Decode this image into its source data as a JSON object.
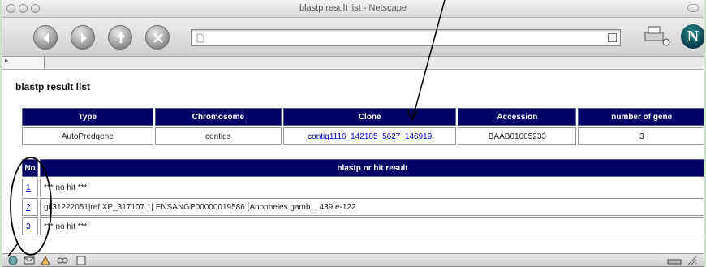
{
  "window": {
    "title": "blastp result list - Netscape"
  },
  "page": {
    "heading": "blastp result list"
  },
  "main_table": {
    "headers": [
      "Type",
      "Chromosome",
      "Clone",
      "Accession",
      "number of gene"
    ],
    "row": {
      "type": "AutoPredgene",
      "chromosome": "contigs",
      "clone": "contig1116_142105_5627_146919",
      "accession": "BAAB01005233",
      "gene_count": "3"
    }
  },
  "hits_table": {
    "headers": [
      "No",
      "blastp nr hit result"
    ],
    "rows": [
      {
        "no": "1",
        "result": "*** no hit ***"
      },
      {
        "no": "2",
        "result": "gi|31222051|ref|XP_317107.1| ENSANGP00000019586 [Anopheles gamb... 439 e-122"
      },
      {
        "no": "3",
        "result": "*** no hit ***"
      }
    ]
  },
  "icons": {
    "back": "back-arrow-icon",
    "forward": "forward-arrow-icon",
    "reload": "reload-icon",
    "stop": "stop-icon",
    "print": "print-icon",
    "logo": "netscape-logo"
  },
  "colors": {
    "header_bg": "#000066",
    "link": "#0000cc",
    "background": "#c9e3c9"
  }
}
